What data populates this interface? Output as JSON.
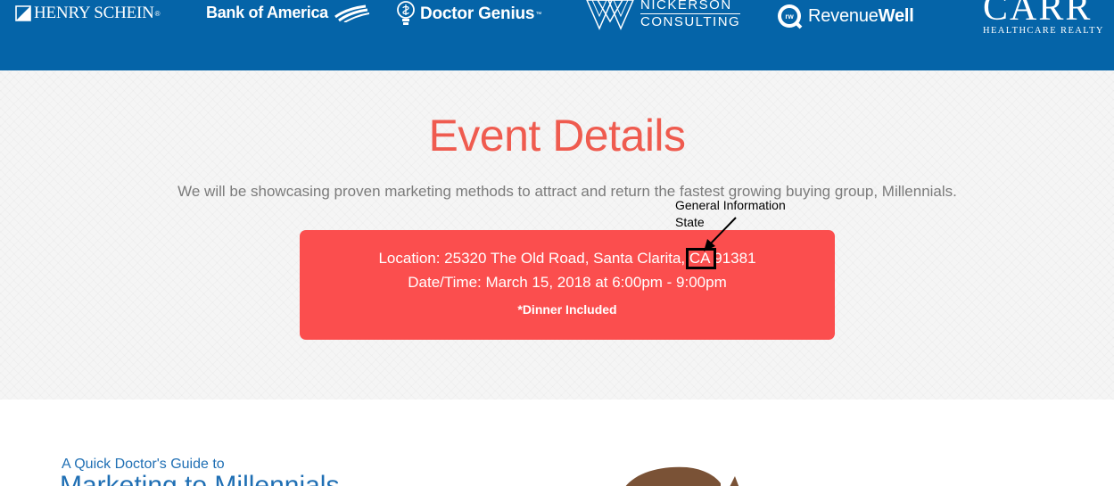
{
  "sponsors": {
    "henry_schein": {
      "name": "HENRY SCHEIN",
      "mark": "®"
    },
    "bank_of_america": {
      "name": "Bank of America"
    },
    "doctor_genius": {
      "name": "Doctor Genius",
      "mark": "™"
    },
    "nickerson": {
      "line1": "NICKERSON",
      "line2": "CONSULTING"
    },
    "revenuewell": {
      "name_light": "Revenue",
      "name_bold": "Well",
      "badge": "rw"
    },
    "carr": {
      "name": "CARR",
      "tagline": "HEALTHCARE REALTY"
    }
  },
  "event": {
    "title": "Event Details",
    "description": "We will be showcasing proven marketing methods to attract and return the fastest growing buying group, Millennials.",
    "location": "Location: 25320 The Old Road, Santa Clarita, CA 91381",
    "datetime": "Date/Time: March 15, 2018 at 6:00pm - 9:00pm",
    "dinner": "*Dinner Included"
  },
  "annotation": {
    "line1": "General Information",
    "line2": "State"
  },
  "guide": {
    "kicker": "A Quick Doctor's Guide to",
    "title": "Marketing to Millennials"
  },
  "colors": {
    "header_blue": "#0564a8",
    "title_red": "#ef5b4f",
    "box_red": "#fb4e4e",
    "link_blue": "#1f6fb4"
  }
}
